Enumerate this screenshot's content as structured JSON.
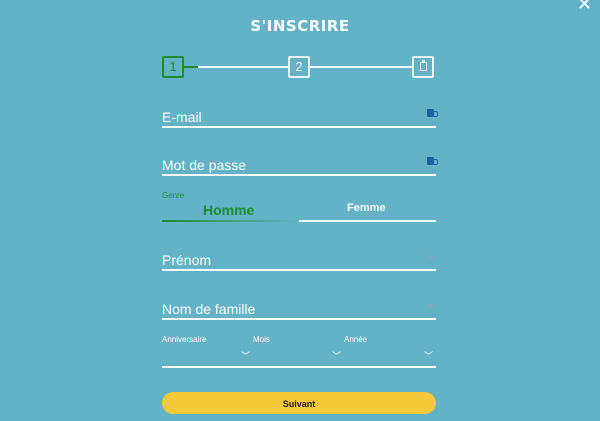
{
  "close_symbol": "✕",
  "title": "S'INSCRIRE",
  "stepper": {
    "steps": [
      "1",
      "2"
    ],
    "step3_icon": "clipboard-icon",
    "active_color": "#1f8a2e"
  },
  "fields": {
    "email": {
      "label": "E-mail",
      "icon": "key-icon"
    },
    "password": {
      "label": "Mot de passe",
      "icon": "key-icon"
    },
    "genre": {
      "label": "Genre",
      "options": [
        "Homme",
        "Femme"
      ],
      "selected": "Homme"
    },
    "first_name": {
      "label": "Prénom",
      "icon": "user-icon"
    },
    "last_name": {
      "label": "Nom de famille",
      "icon": "user-icon"
    }
  },
  "birthday": {
    "day_label": "Anniversaire",
    "month_label": "Mois",
    "year_label": "Année"
  },
  "submit_label": "Suivant",
  "colors": {
    "background": "#63b2c6",
    "accent_green": "#1f8a2e",
    "button": "#f5c93a",
    "key_icon": "#1e5f9e"
  }
}
